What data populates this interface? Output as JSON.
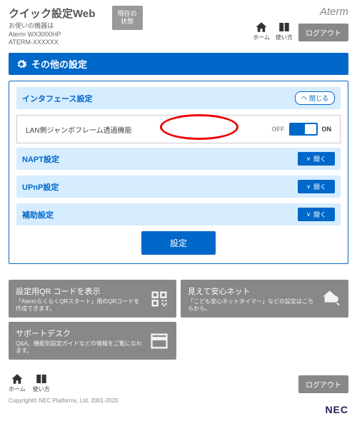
{
  "header": {
    "title": "クイック設定Web",
    "device_label": "お使いの機器は",
    "device_model": "Aterm WX3000HP",
    "device_id": "ATERM-XXXXXX",
    "status_btn_l1": "現在の",
    "status_btn_l2": "状態",
    "brand": "Aterm",
    "home_label": "ホーム",
    "usage_label": "使い方",
    "logout": "ログアウト"
  },
  "section": {
    "title": "その他の設定"
  },
  "interface": {
    "title": "インタフェース設定",
    "close": "閉じる",
    "jumbo_label": "LAN側ジャンボフレーム透過機能",
    "off": "OFF",
    "on": "ON"
  },
  "collapsed": [
    {
      "title": "NAPT設定",
      "open": "開く"
    },
    {
      "title": "UPnP設定",
      "open": "開く"
    },
    {
      "title": "補助設定",
      "open": "開く"
    }
  ],
  "apply_btn": "設定",
  "tiles": {
    "qr_title": "設定用QR コードを表示",
    "qr_desc": "「AtermらくらくQRスタート」用のQRコードを作成できます。",
    "safety_title": "見えて安心ネット",
    "safety_desc": "「こども安心ネットタイマー」などの設定はこちらから。",
    "support_title": "サポートデスク",
    "support_desc": "Q&A、機能別設定ガイドなどの情報をご覧になれます。"
  },
  "footer": {
    "home_label": "ホーム",
    "usage_label": "使い方",
    "logout": "ログアウト",
    "copyright": "Copyright© NEC Platforms, Ltd. 2001-2020",
    "nec": "NEC"
  }
}
